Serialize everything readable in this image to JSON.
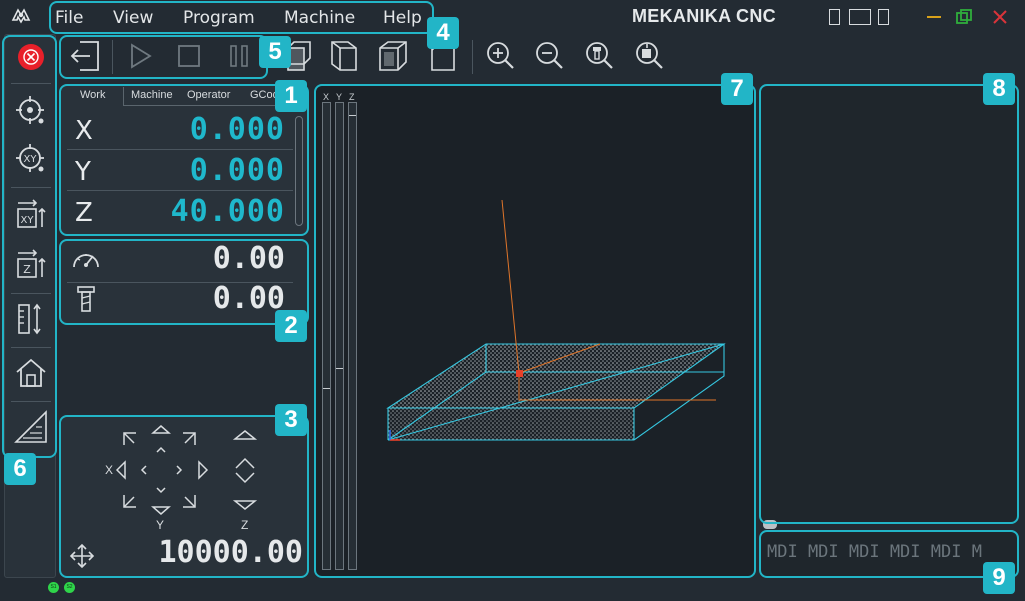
{
  "menu": {
    "items": [
      {
        "label": "File"
      },
      {
        "label": "View"
      },
      {
        "label": "Program"
      },
      {
        "label": "Machine"
      },
      {
        "label": "Help"
      }
    ]
  },
  "window": {
    "title": "MEKANIKA CNC"
  },
  "dro": {
    "tabs": [
      "Work",
      "Machine",
      "Operator",
      "GCode"
    ],
    "active_tab": "Work",
    "axes": [
      {
        "label": "X",
        "value": "0.000"
      },
      {
        "label": "Y",
        "value": "0.000"
      },
      {
        "label": "Z",
        "value": "40.000"
      }
    ]
  },
  "speeds": {
    "feed": "0.00",
    "spindle": "0.00"
  },
  "jog": {
    "x_label": "X",
    "y_label": "Y",
    "z_label": "Z",
    "step": "10000.00"
  },
  "viewport": {
    "axis_bars": [
      "X",
      "Y",
      "Z"
    ]
  },
  "mdi": {
    "placeholder_text": "MDI MDI MDI MDI MDI M"
  },
  "status_leds": [
    "S1",
    "S2"
  ],
  "badges": [
    "1",
    "2",
    "3",
    "4",
    "5",
    "6",
    "7",
    "8",
    "9"
  ],
  "colors": {
    "accent": "#22b5c7",
    "dro_value": "#1fb8cc",
    "estop": "#e8202a",
    "background": "#232b33",
    "toolpath": "#e0752a",
    "stock_outline": "#35c7e0"
  }
}
